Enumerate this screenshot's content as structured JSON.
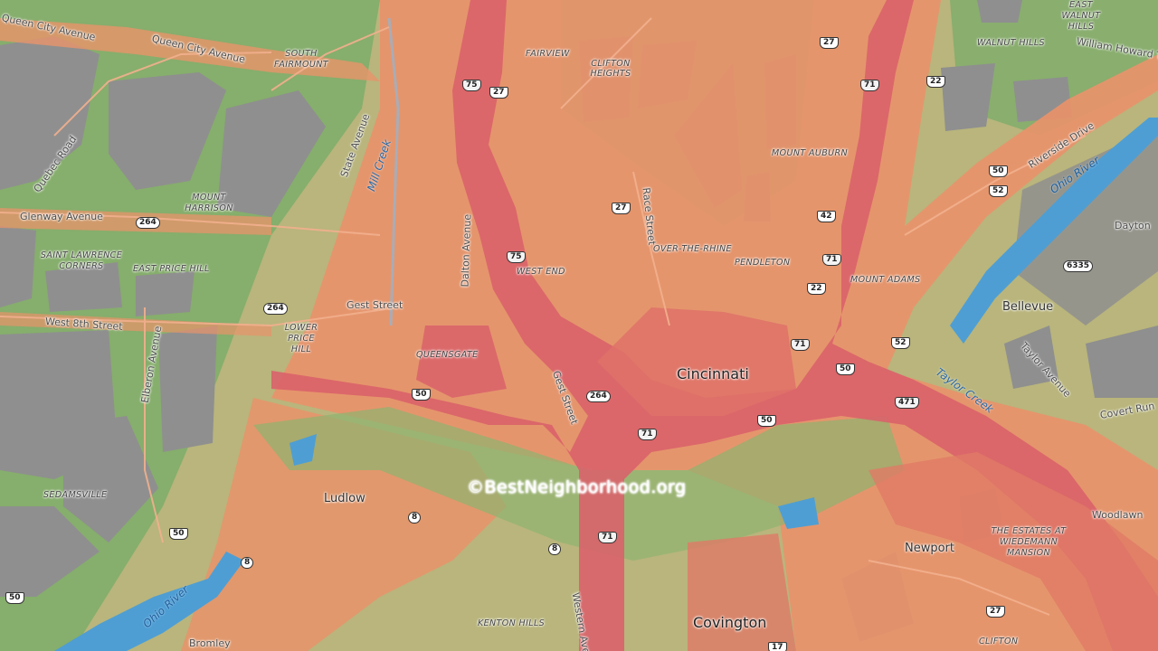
{
  "map": {
    "watermark": "©BestNeighborhood.org",
    "colors": {
      "high": "#d9626a",
      "medium": "#e8936a",
      "low": "#c7b56b",
      "lowest": "#7dad6a",
      "river": "#4e9ed4",
      "built": "#8f8f8f"
    },
    "places": {
      "cincinnati": "Cincinnati",
      "covington": "Covington",
      "ludlow": "Ludlow",
      "newport": "Newport",
      "bellevue": "Bellevue",
      "dayton": "Dayton",
      "woodlawn": "Woodlawn",
      "bromley": "Bromley"
    },
    "neighborhoods": {
      "fairview": "FAIRVIEW",
      "clifton_heights": "CLIFTON HEIGHTS",
      "south_fairmount": "SOUTH FAIRMOUNT",
      "mount_harrison": "MOUNT HARRISON",
      "saint_lawrence_corners": "SAINT LAWRENCE CORNERS",
      "east_price_hill": "EAST PRICE HILL",
      "lower_price_hill": "LOWER PRICE HILL",
      "queensgate": "QUEENSGATE",
      "west_end": "WEST END",
      "over_the_rhine": "OVER-THE-RHINE",
      "pendleton": "PENDLETON",
      "mount_auburn": "MOUNT AUBURN",
      "mount_adams": "MOUNT ADAMS",
      "walnut_hills": "WALNUT HILLS",
      "east_walnut_hills": "EAST WALNUT HILLS",
      "sedamsville": "SEDAMSVILLE",
      "kenton_hills": "KENTON HILLS",
      "clifton": "CLIFTON",
      "estates": "THE ESTATES AT WIEDEMANN MANSION"
    },
    "streets": {
      "queen_city_ave_1": "Queen City Avenue",
      "queen_city_ave_2": "Queen City Avenue",
      "quebec_road": "Quebec Road",
      "state_avenue": "State Avenue",
      "glenway_avenue": "Glenway Avenue",
      "west_8th": "West 8th Street",
      "elberon_avenue": "Elberon Avenue",
      "gest_street": "Gest Street",
      "gest_street_2": "Gest Street",
      "dalton_avenue": "Dalton Avenue",
      "race_street": "Race Street",
      "riverside_drive": "Riverside Drive",
      "taylor_avenue": "Taylor Avenue",
      "covert_run": "Covert Run",
      "western_ave": "Western Ave",
      "william_howard": "William Howard T"
    },
    "water": {
      "ohio_river_1": "Ohio River",
      "ohio_river_2": "Ohio River",
      "mill_creek": "Mill Creek",
      "taylor_creek": "Taylor Creek"
    },
    "shields": {
      "i75_a": "75",
      "i75_b": "75",
      "us27_a": "27",
      "us27_b": "27",
      "us27_c": "27",
      "i71_a": "71",
      "i71_b": "71",
      "i71_c": "71",
      "i71_d": "71",
      "i71_e": "71",
      "us22_a": "22",
      "us22_b": "22",
      "us42": "42",
      "us50_a": "50",
      "us50_b": "50",
      "us50_c": "50",
      "us50_d": "50",
      "us50_e": "50",
      "us52_a": "52",
      "us52_b": "52",
      "r264_a": "264",
      "r264_b": "264",
      "r264_c": "264",
      "i471": "471",
      "r6335": "6335",
      "r8_a": "8",
      "r8_b": "8",
      "r8_c": "8",
      "us17": "17",
      "us50_west": "50",
      "us27_south": "27"
    }
  }
}
